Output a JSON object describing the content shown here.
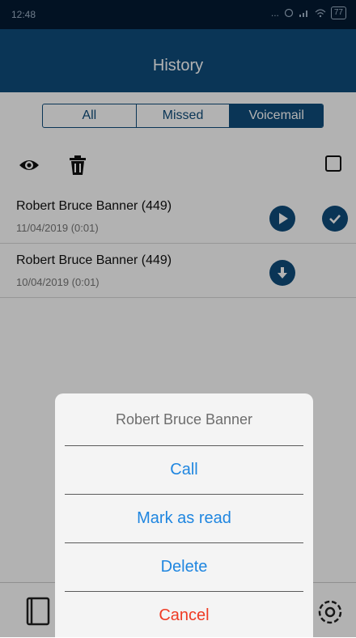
{
  "status_bar": {
    "time": "12:48",
    "signal": "...",
    "battery": "77"
  },
  "header": {
    "title": "History"
  },
  "tabs": [
    {
      "label": "All",
      "active": false
    },
    {
      "label": "Missed",
      "active": false
    },
    {
      "label": "Voicemail",
      "active": true
    }
  ],
  "toolbar": {
    "view_icon": "eye-icon",
    "delete_icon": "trash-icon",
    "select_all_checked": false
  },
  "voicemails": [
    {
      "name": "Robert Bruce Banner (449)",
      "meta": "11/04/2019 (0:01)",
      "action_icon": "play-icon",
      "read": true
    },
    {
      "name": "Robert Bruce Banner (449)",
      "meta": "10/04/2019 (0:01)",
      "action_icon": "download-icon",
      "read": false
    }
  ],
  "bottom_nav": {
    "items": [
      "contacts-icon",
      "history-icon",
      "dialpad-icon",
      "chat-icon",
      "settings-icon"
    ]
  },
  "action_sheet": {
    "title": "Robert Bruce Banner",
    "options": [
      "Call",
      "Mark as read",
      "Delete",
      "Cancel"
    ]
  },
  "colors": {
    "primary": "#0f4d7c",
    "status_bar": "#041a33",
    "link": "#1f86e0",
    "cancel": "#ef3b24"
  }
}
